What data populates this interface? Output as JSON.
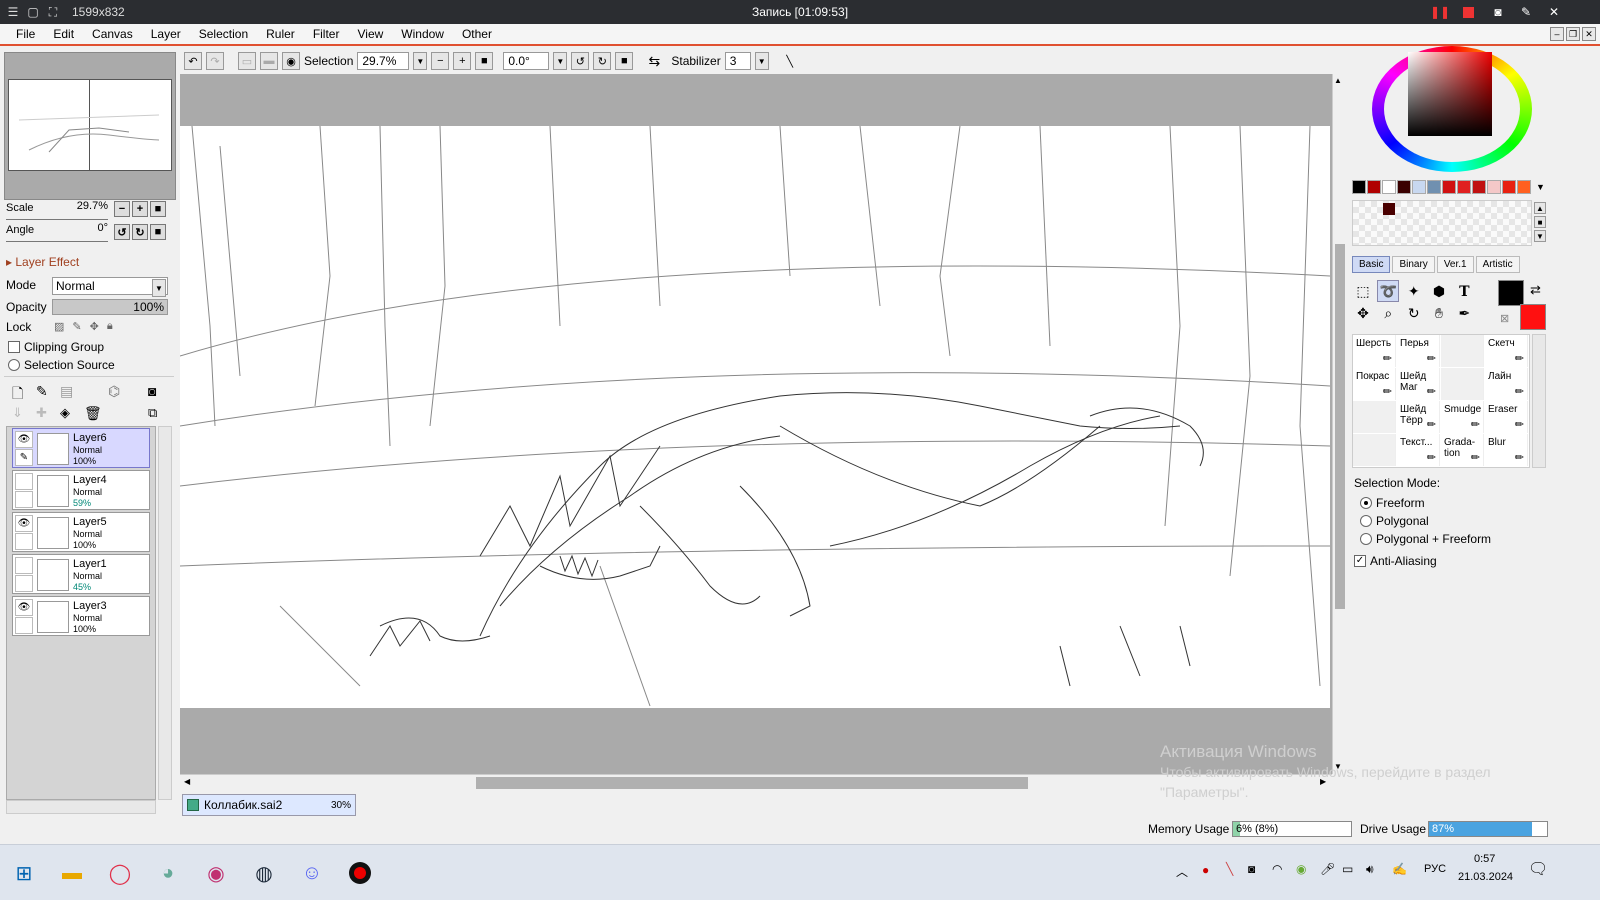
{
  "recorder": {
    "dimensions": "1599x832",
    "title": "Запись [01:09:53]"
  },
  "menu": [
    "File",
    "Edit",
    "Canvas",
    "Layer",
    "Selection",
    "Ruler",
    "Filter",
    "View",
    "Window",
    "Other"
  ],
  "toolbar": {
    "selection_label": "Selection",
    "zoom": "29.7%",
    "angle": "0.0°",
    "stabilizer_label": "Stabilizer",
    "stabilizer_value": "3"
  },
  "navigator": {
    "scale_label": "Scale",
    "scale_value": "29.7%",
    "angle_label": "Angle",
    "angle_value": "0°"
  },
  "layer_panel": {
    "effect_label": "Layer Effect",
    "mode_label": "Mode",
    "mode_value": "Normal",
    "opacity_label": "Opacity",
    "opacity_value": "100%",
    "lock_label": "Lock",
    "clipping_label": "Clipping Group",
    "selection_source_label": "Selection Source",
    "layers": [
      {
        "name": "Layer6",
        "mode": "Normal",
        "opacity": "100%",
        "visible": true,
        "selected": true
      },
      {
        "name": "Layer4",
        "mode": "Normal",
        "opacity": "59%",
        "visible": false,
        "selected": false
      },
      {
        "name": "Layer5",
        "mode": "Normal",
        "opacity": "100%",
        "visible": true,
        "selected": false
      },
      {
        "name": "Layer1",
        "mode": "Normal",
        "opacity": "45%",
        "visible": false,
        "selected": false
      },
      {
        "name": "Layer3",
        "mode": "Normal",
        "opacity": "100%",
        "visible": true,
        "selected": false
      }
    ]
  },
  "document": {
    "name": "Коллабик.sai2",
    "zoom": "30%"
  },
  "palette": [
    "#000000",
    "#b00000",
    "#ffffff",
    "#3a0000",
    "#c8d8f0",
    "#7090b0",
    "#d01010",
    "#e02020",
    "#c01010",
    "#f4c8c8",
    "#e82010",
    "#ff6020"
  ],
  "tool_tabs": [
    "Basic",
    "Binary",
    "Ver.1",
    "Artistic"
  ],
  "brushes": [
    {
      "name": "Шерсть"
    },
    {
      "name": "Перья"
    },
    {
      "name": ""
    },
    {
      "name": "Скетч"
    },
    {
      "name": "Покрас"
    },
    {
      "name": "Шейд Маг"
    },
    {
      "name": ""
    },
    {
      "name": "Лайн"
    },
    {
      "name": ""
    },
    {
      "name": "Шейд Тёрр"
    },
    {
      "name": "Smudge"
    },
    {
      "name": "Eraser"
    },
    {
      "name": ""
    },
    {
      "name": "Текст..."
    },
    {
      "name": "Grada-tion"
    },
    {
      "name": "Blur"
    }
  ],
  "selection_mode": {
    "label": "Selection Mode:",
    "options": [
      "Freeform",
      "Polygonal",
      "Polygonal + Freeform"
    ],
    "selected": "Freeform"
  },
  "anti_aliasing": {
    "label": "Anti-Aliasing",
    "checked": true
  },
  "status": {
    "memory_label": "Memory Usage",
    "memory_value": "6% (8%)",
    "memory_fraction": 0.06,
    "drive_label": "Drive Usage",
    "drive_value": "87%",
    "drive_fraction": 0.87
  },
  "watermark": {
    "line1": "Активация Windows",
    "line2": "Чтобы активировать Windows, перейдите в раздел",
    "line3": "\"Параметры\"."
  },
  "taskbar": {
    "lang": "РУС",
    "time": "0:57",
    "date": "21.03.2024"
  },
  "colors": {
    "accent": "#e05030",
    "primary": "#000000",
    "secondary": "#ff1010"
  }
}
